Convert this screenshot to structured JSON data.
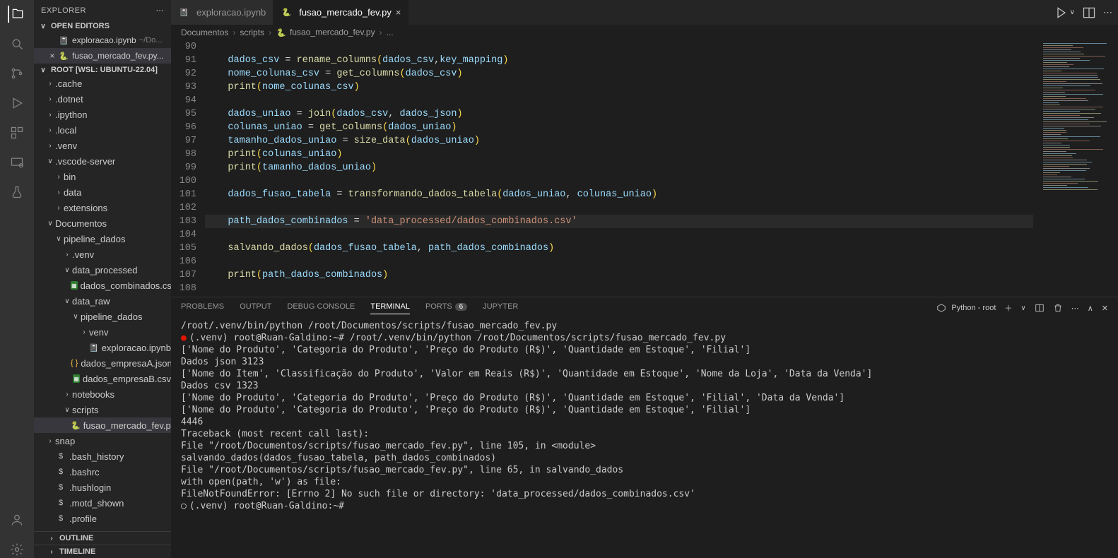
{
  "explorer": {
    "title": "EXPLORER",
    "open_editors": "OPEN EDITORS",
    "root_label": "ROOT [WSL: UBUNTU-22.04]",
    "outline": "OUTLINE",
    "timeline": "TIMELINE",
    "open": [
      {
        "name": "exploracao.ipynb",
        "tail": "~/Do..."
      },
      {
        "name": "fusao_mercado_fev.py...",
        "active": true
      }
    ],
    "tree": [
      {
        "d": 1,
        "tw": ">",
        "label": ".cache"
      },
      {
        "d": 1,
        "tw": ">",
        "label": ".dotnet"
      },
      {
        "d": 1,
        "tw": ">",
        "label": ".ipython"
      },
      {
        "d": 1,
        "tw": ">",
        "label": ".local"
      },
      {
        "d": 1,
        "tw": ">",
        "label": ".venv"
      },
      {
        "d": 1,
        "tw": "v",
        "label": ".vscode-server"
      },
      {
        "d": 2,
        "tw": ">",
        "label": "bin"
      },
      {
        "d": 2,
        "tw": ">",
        "label": "data"
      },
      {
        "d": 2,
        "tw": ">",
        "label": "extensions"
      },
      {
        "d": 1,
        "tw": "v",
        "label": "Documentos"
      },
      {
        "d": 2,
        "tw": "v",
        "label": "pipeline_dados"
      },
      {
        "d": 3,
        "tw": ">",
        "label": ".venv"
      },
      {
        "d": 3,
        "tw": "v",
        "label": "data_processed"
      },
      {
        "d": 4,
        "tw": "",
        "icon": "csv",
        "label": "dados_combinados.csv"
      },
      {
        "d": 3,
        "tw": "v",
        "label": "data_raw"
      },
      {
        "d": 4,
        "tw": "v",
        "label": "pipeline_dados"
      },
      {
        "d": 5,
        "tw": ">",
        "label": "venv"
      },
      {
        "d": 5,
        "tw": "",
        "icon": "nb",
        "label": "exploracao.ipynb"
      },
      {
        "d": 4,
        "tw": "",
        "icon": "json",
        "label": "dados_empresaA.json"
      },
      {
        "d": 4,
        "tw": "",
        "icon": "csv",
        "label": "dados_empresaB.csv"
      },
      {
        "d": 3,
        "tw": ">",
        "label": "notebooks"
      },
      {
        "d": 3,
        "tw": "v",
        "label": "scripts"
      },
      {
        "d": 4,
        "tw": "",
        "icon": "py",
        "label": "fusao_mercado_fev.py",
        "sel": true
      },
      {
        "d": 1,
        "tw": ">",
        "label": "snap"
      },
      {
        "d": 1,
        "tw": "",
        "icon": "dollar",
        "label": ".bash_history"
      },
      {
        "d": 1,
        "tw": "",
        "icon": "dollar",
        "label": ".bashrc"
      },
      {
        "d": 1,
        "tw": "",
        "icon": "dollar",
        "label": ".hushlogin"
      },
      {
        "d": 1,
        "tw": "",
        "icon": "dollar",
        "label": ".motd_shown"
      },
      {
        "d": 1,
        "tw": "",
        "icon": "dollar",
        "label": ".profile"
      }
    ]
  },
  "tabs": [
    {
      "icon": "nb",
      "label": "exploracao.ipynb",
      "active": false
    },
    {
      "icon": "py",
      "label": "fusao_mercado_fev.py",
      "active": true
    }
  ],
  "breadcrumb": [
    "Documentos",
    "scripts",
    "fusao_mercado_fev.py",
    "..."
  ],
  "code": {
    "start": 90,
    "lines": [
      "",
      "    dados_csv = rename_columns(dados_csv,key_mapping)",
      "    nome_colunas_csv = get_columns(dados_csv)",
      "    print(nome_colunas_csv)",
      "",
      "    dados_uniao = join(dados_csv, dados_json)",
      "    colunas_uniao = get_columns(dados_uniao)",
      "    tamanho_dados_uniao = size_data(dados_uniao)",
      "    print(colunas_uniao)",
      "    print(tamanho_dados_uniao)",
      "",
      "    dados_fusao_tabela = transformando_dados_tabela(dados_uniao, colunas_uniao)",
      "",
      "    path_dados_combinados = 'data_processed/dados_combinados.csv'",
      "",
      "    salvando_dados(dados_fusao_tabela, path_dados_combinados)",
      "",
      "    print(path_dados_combinados)",
      ""
    ],
    "highlight_line": 103
  },
  "panel": {
    "tabs": {
      "problems": "PROBLEMS",
      "output": "OUTPUT",
      "debug": "DEBUG CONSOLE",
      "terminal": "TERMINAL",
      "ports": "PORTS",
      "ports_badge": "6",
      "jupyter": "JUPYTER"
    },
    "right_label": "Python - root",
    "terminal": [
      "/root/.venv/bin/python /root/Documentos/scripts/fusao_mercado_fev.py",
      "(.venv) root@Ruan-Galdino:~# /root/.venv/bin/python /root/Documentos/scripts/fusao_mercado_fev.py",
      "['Nome do Produto', 'Categoria do Produto', 'Preço do Produto (R$)', 'Quantidade em Estoque', 'Filial']",
      "Dados json 3123",
      "['Nome do Item', 'Classificação do Produto', 'Valor em Reais (R$)', 'Quantidade em Estoque', 'Nome da Loja', 'Data da Venda']",
      "Dados csv 1323",
      "['Nome do Produto', 'Categoria do Produto', 'Preço do Produto (R$)', 'Quantidade em Estoque', 'Filial', 'Data da Venda']",
      "['Nome do Produto', 'Categoria do Produto', 'Preço do Produto (R$)', 'Quantidade em Estoque', 'Filial']",
      "4446",
      "Traceback (most recent call last):",
      "  File \"/root/Documentos/scripts/fusao_mercado_fev.py\", line 105, in <module>",
      "    salvando_dados(dados_fusao_tabela, path_dados_combinados)",
      "  File \"/root/Documentos/scripts/fusao_mercado_fev.py\", line 65, in salvando_dados",
      "    with open(path, 'w') as file:",
      "FileNotFoundError: [Errno 2] No such file or directory: 'data_processed/dados_combinados.csv'",
      "(.venv) root@Ruan-Galdino:~# "
    ]
  }
}
